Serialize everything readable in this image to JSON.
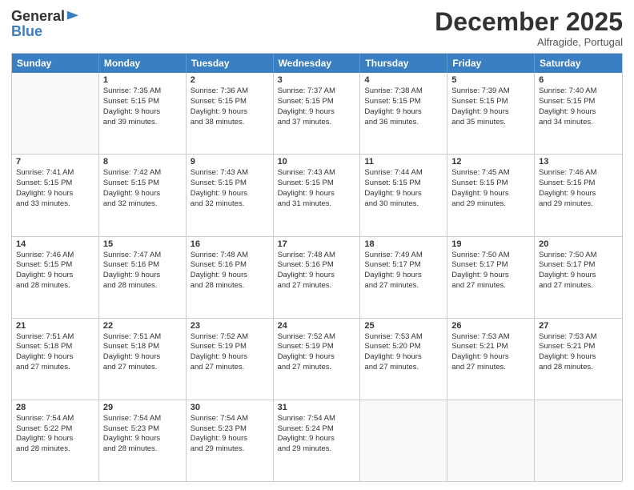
{
  "logo": {
    "general": "General",
    "blue": "Blue"
  },
  "header": {
    "month": "December 2025",
    "location": "Alfragide, Portugal"
  },
  "weekdays": [
    "Sunday",
    "Monday",
    "Tuesday",
    "Wednesday",
    "Thursday",
    "Friday",
    "Saturday"
  ],
  "weeks": [
    [
      {
        "day": null,
        "lines": []
      },
      {
        "day": "1",
        "lines": [
          "Sunrise: 7:35 AM",
          "Sunset: 5:15 PM",
          "Daylight: 9 hours",
          "and 39 minutes."
        ]
      },
      {
        "day": "2",
        "lines": [
          "Sunrise: 7:36 AM",
          "Sunset: 5:15 PM",
          "Daylight: 9 hours",
          "and 38 minutes."
        ]
      },
      {
        "day": "3",
        "lines": [
          "Sunrise: 7:37 AM",
          "Sunset: 5:15 PM",
          "Daylight: 9 hours",
          "and 37 minutes."
        ]
      },
      {
        "day": "4",
        "lines": [
          "Sunrise: 7:38 AM",
          "Sunset: 5:15 PM",
          "Daylight: 9 hours",
          "and 36 minutes."
        ]
      },
      {
        "day": "5",
        "lines": [
          "Sunrise: 7:39 AM",
          "Sunset: 5:15 PM",
          "Daylight: 9 hours",
          "and 35 minutes."
        ]
      },
      {
        "day": "6",
        "lines": [
          "Sunrise: 7:40 AM",
          "Sunset: 5:15 PM",
          "Daylight: 9 hours",
          "and 34 minutes."
        ]
      }
    ],
    [
      {
        "day": "7",
        "lines": [
          "Sunrise: 7:41 AM",
          "Sunset: 5:15 PM",
          "Daylight: 9 hours",
          "and 33 minutes."
        ]
      },
      {
        "day": "8",
        "lines": [
          "Sunrise: 7:42 AM",
          "Sunset: 5:15 PM",
          "Daylight: 9 hours",
          "and 32 minutes."
        ]
      },
      {
        "day": "9",
        "lines": [
          "Sunrise: 7:43 AM",
          "Sunset: 5:15 PM",
          "Daylight: 9 hours",
          "and 32 minutes."
        ]
      },
      {
        "day": "10",
        "lines": [
          "Sunrise: 7:43 AM",
          "Sunset: 5:15 PM",
          "Daylight: 9 hours",
          "and 31 minutes."
        ]
      },
      {
        "day": "11",
        "lines": [
          "Sunrise: 7:44 AM",
          "Sunset: 5:15 PM",
          "Daylight: 9 hours",
          "and 30 minutes."
        ]
      },
      {
        "day": "12",
        "lines": [
          "Sunrise: 7:45 AM",
          "Sunset: 5:15 PM",
          "Daylight: 9 hours",
          "and 29 minutes."
        ]
      },
      {
        "day": "13",
        "lines": [
          "Sunrise: 7:46 AM",
          "Sunset: 5:15 PM",
          "Daylight: 9 hours",
          "and 29 minutes."
        ]
      }
    ],
    [
      {
        "day": "14",
        "lines": [
          "Sunrise: 7:46 AM",
          "Sunset: 5:15 PM",
          "Daylight: 9 hours",
          "and 28 minutes."
        ]
      },
      {
        "day": "15",
        "lines": [
          "Sunrise: 7:47 AM",
          "Sunset: 5:16 PM",
          "Daylight: 9 hours",
          "and 28 minutes."
        ]
      },
      {
        "day": "16",
        "lines": [
          "Sunrise: 7:48 AM",
          "Sunset: 5:16 PM",
          "Daylight: 9 hours",
          "and 28 minutes."
        ]
      },
      {
        "day": "17",
        "lines": [
          "Sunrise: 7:48 AM",
          "Sunset: 5:16 PM",
          "Daylight: 9 hours",
          "and 27 minutes."
        ]
      },
      {
        "day": "18",
        "lines": [
          "Sunrise: 7:49 AM",
          "Sunset: 5:17 PM",
          "Daylight: 9 hours",
          "and 27 minutes."
        ]
      },
      {
        "day": "19",
        "lines": [
          "Sunrise: 7:50 AM",
          "Sunset: 5:17 PM",
          "Daylight: 9 hours",
          "and 27 minutes."
        ]
      },
      {
        "day": "20",
        "lines": [
          "Sunrise: 7:50 AM",
          "Sunset: 5:17 PM",
          "Daylight: 9 hours",
          "and 27 minutes."
        ]
      }
    ],
    [
      {
        "day": "21",
        "lines": [
          "Sunrise: 7:51 AM",
          "Sunset: 5:18 PM",
          "Daylight: 9 hours",
          "and 27 minutes."
        ]
      },
      {
        "day": "22",
        "lines": [
          "Sunrise: 7:51 AM",
          "Sunset: 5:18 PM",
          "Daylight: 9 hours",
          "and 27 minutes."
        ]
      },
      {
        "day": "23",
        "lines": [
          "Sunrise: 7:52 AM",
          "Sunset: 5:19 PM",
          "Daylight: 9 hours",
          "and 27 minutes."
        ]
      },
      {
        "day": "24",
        "lines": [
          "Sunrise: 7:52 AM",
          "Sunset: 5:19 PM",
          "Daylight: 9 hours",
          "and 27 minutes."
        ]
      },
      {
        "day": "25",
        "lines": [
          "Sunrise: 7:53 AM",
          "Sunset: 5:20 PM",
          "Daylight: 9 hours",
          "and 27 minutes."
        ]
      },
      {
        "day": "26",
        "lines": [
          "Sunrise: 7:53 AM",
          "Sunset: 5:21 PM",
          "Daylight: 9 hours",
          "and 27 minutes."
        ]
      },
      {
        "day": "27",
        "lines": [
          "Sunrise: 7:53 AM",
          "Sunset: 5:21 PM",
          "Daylight: 9 hours",
          "and 28 minutes."
        ]
      }
    ],
    [
      {
        "day": "28",
        "lines": [
          "Sunrise: 7:54 AM",
          "Sunset: 5:22 PM",
          "Daylight: 9 hours",
          "and 28 minutes."
        ]
      },
      {
        "day": "29",
        "lines": [
          "Sunrise: 7:54 AM",
          "Sunset: 5:23 PM",
          "Daylight: 9 hours",
          "and 28 minutes."
        ]
      },
      {
        "day": "30",
        "lines": [
          "Sunrise: 7:54 AM",
          "Sunset: 5:23 PM",
          "Daylight: 9 hours",
          "and 29 minutes."
        ]
      },
      {
        "day": "31",
        "lines": [
          "Sunrise: 7:54 AM",
          "Sunset: 5:24 PM",
          "Daylight: 9 hours",
          "and 29 minutes."
        ]
      },
      {
        "day": null,
        "lines": []
      },
      {
        "day": null,
        "lines": []
      },
      {
        "day": null,
        "lines": []
      }
    ]
  ]
}
